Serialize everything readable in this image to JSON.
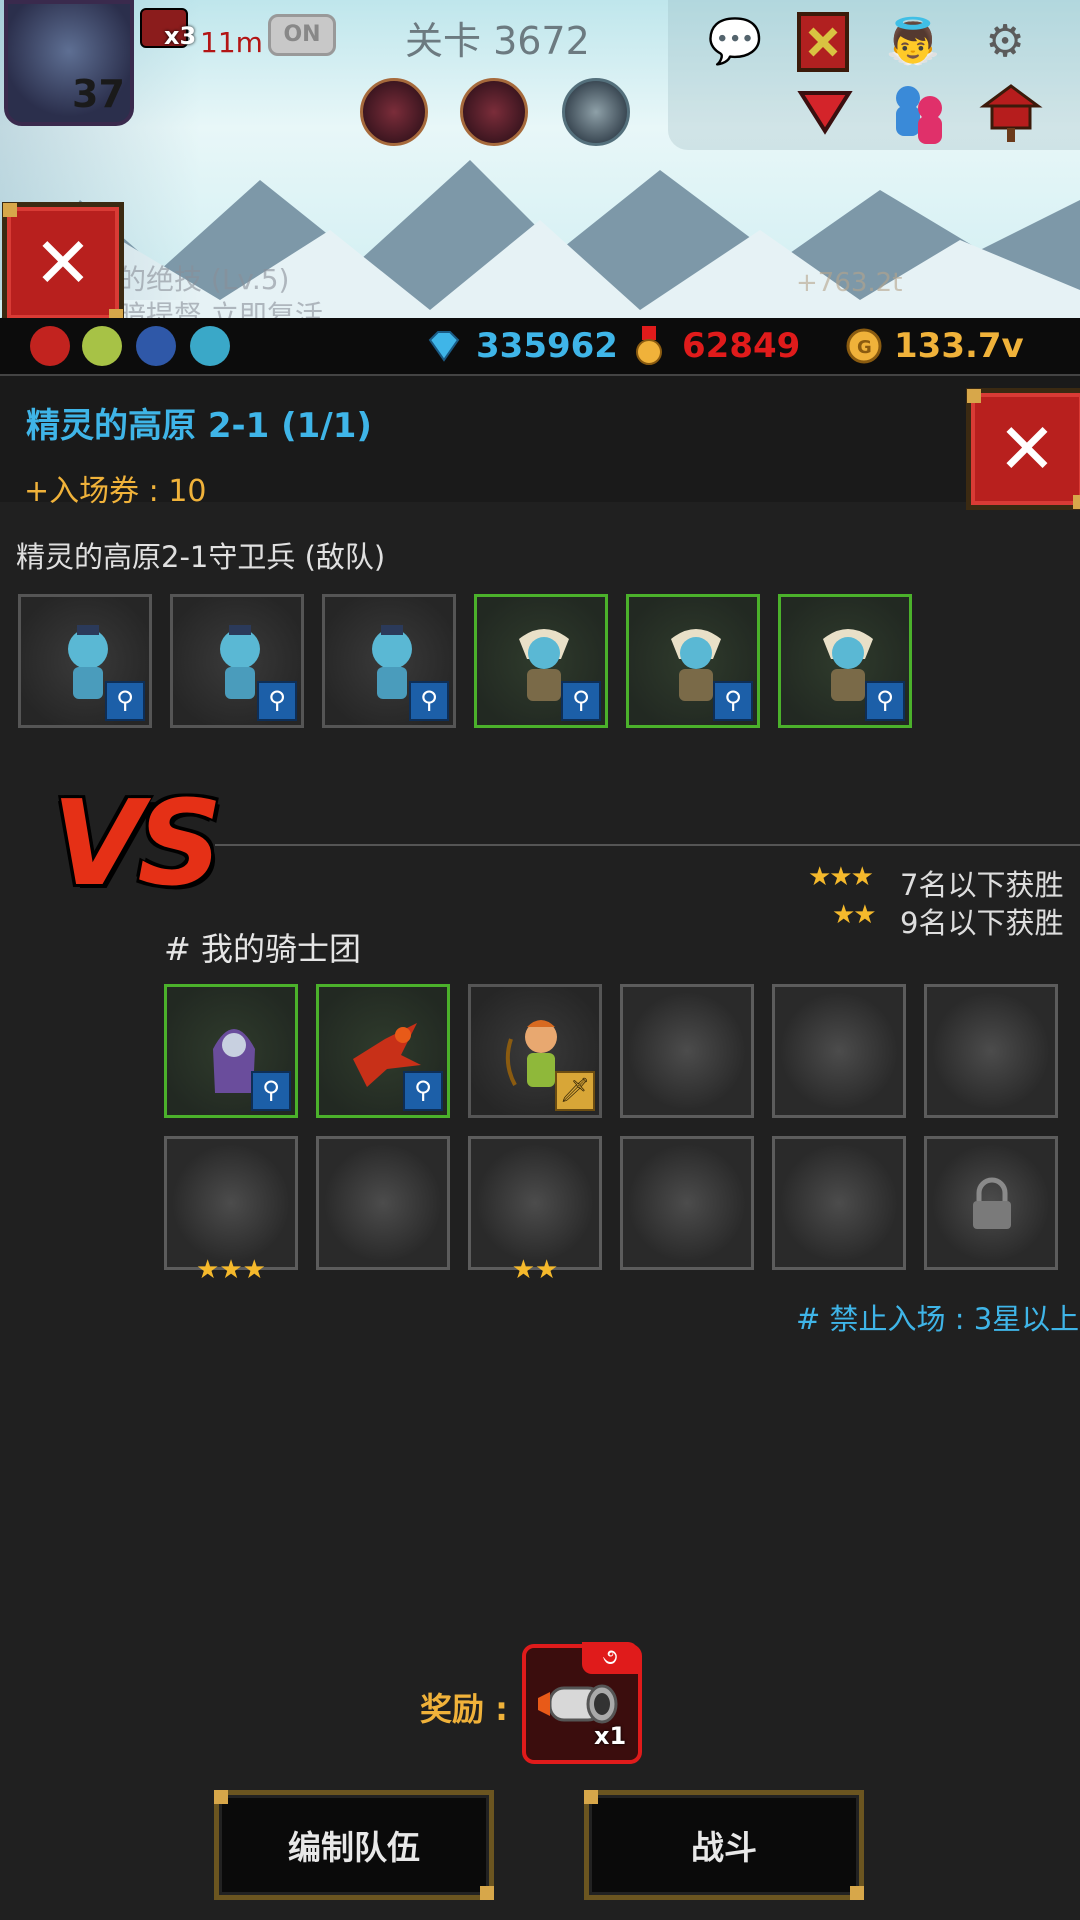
{
  "hud": {
    "level": "37",
    "video_multiplier": "x3",
    "timer": "11m",
    "toggle_label": "ON",
    "stage": "关卡 3672",
    "faded_skill_text": "的绝技 (Lv.5)",
    "faded_hint_text": "暗提督 立即复活",
    "dps_value": "+763.2t",
    "icons": [
      "chat-icon",
      "guild-banner-icon",
      "angel-icon",
      "gear-icon",
      "dropdown-arrow-icon",
      "party-icon",
      "mailbox-icon"
    ]
  },
  "currency": {
    "gems": "335962",
    "medals": "62849",
    "gold": "133.7v",
    "colors": {
      "gems": "#3fb5e8",
      "medals": "#e01b1b",
      "gold": "#f0b23a"
    }
  },
  "panel": {
    "title": "精灵的高原 2-1 (1/1)",
    "ticket": "+入场券 : 10",
    "enemy_title": "精灵的高原2-1守卫兵 (敌队)",
    "vs_label": "VS",
    "condition_3star": "7名以下获胜",
    "condition_2star": "9名以下获胜",
    "my_team_title": "# 我的骑士团",
    "forbid": "# 禁止入场 : 3星以上",
    "reward_label": "奖励 :",
    "reward_count": "x1",
    "reward_tag": "૭",
    "btn_edit": "编制队伍",
    "btn_fight": "战斗"
  },
  "enemies": [
    {
      "type": "goblin",
      "frame": "gray",
      "badge": "magic-staff-icon"
    },
    {
      "type": "goblin",
      "frame": "gray",
      "badge": "magic-staff-icon"
    },
    {
      "type": "goblin",
      "frame": "gray",
      "badge": "magic-staff-icon"
    },
    {
      "type": "goblin-shaman",
      "frame": "green",
      "badge": "magic-staff-icon"
    },
    {
      "type": "goblin-shaman",
      "frame": "green",
      "badge": "magic-staff-icon"
    },
    {
      "type": "goblin-shaman",
      "frame": "green",
      "badge": "magic-staff-icon"
    }
  ],
  "team": {
    "row1": [
      {
        "type": "hooded-mage",
        "frame": "green",
        "badge": "magic-staff-icon"
      },
      {
        "type": "phoenix",
        "frame": "green",
        "badge": "magic-staff-icon"
      },
      {
        "type": "archer",
        "frame": "gray",
        "badge": "sword-icon"
      },
      {
        "type": "empty"
      },
      {
        "type": "empty"
      },
      {
        "type": "empty"
      }
    ],
    "row2": [
      {
        "type": "empty",
        "stars": "★★★"
      },
      {
        "type": "empty"
      },
      {
        "type": "empty",
        "stars": "★★"
      },
      {
        "type": "empty"
      },
      {
        "type": "empty"
      },
      {
        "type": "locked"
      }
    ]
  }
}
